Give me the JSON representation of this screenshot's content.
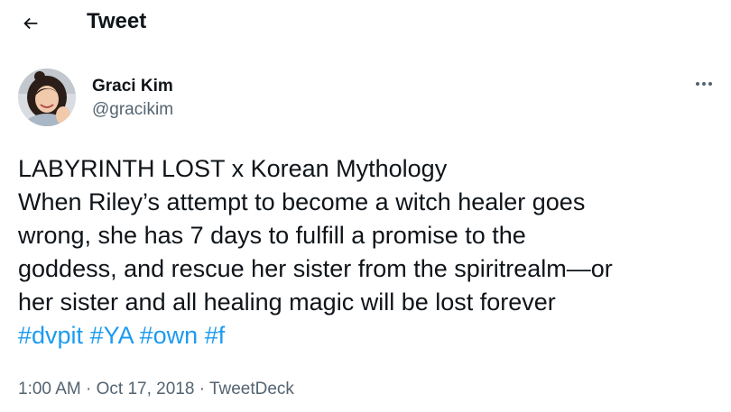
{
  "header": {
    "back_icon": "arrow-left-icon",
    "title": "Tweet"
  },
  "author": {
    "name": "Graci Kim",
    "handle": "@gracikim",
    "avatar_icon": "avatar-photo"
  },
  "more_icon": "more-horizontal-icon",
  "tweet": {
    "lines": [
      "LABYRINTH LOST x Korean Mythology",
      "When Riley’s attempt to become a witch healer goes",
      "wrong, she has 7 days to fulfill a promise to the",
      "goddess, and rescue her sister from the spiritrealm—or",
      "her sister and all healing magic will be lost forever"
    ],
    "hashtags": [
      "#dvpit",
      "#YA",
      "#own",
      "#f"
    ]
  },
  "meta": {
    "time": "1:00 AM",
    "date": "Oct 17, 2018",
    "source": "TweetDeck",
    "separator": "·"
  },
  "colors": {
    "text": "#0f1419",
    "secondary": "#536471",
    "link": "#1d9bf0"
  }
}
